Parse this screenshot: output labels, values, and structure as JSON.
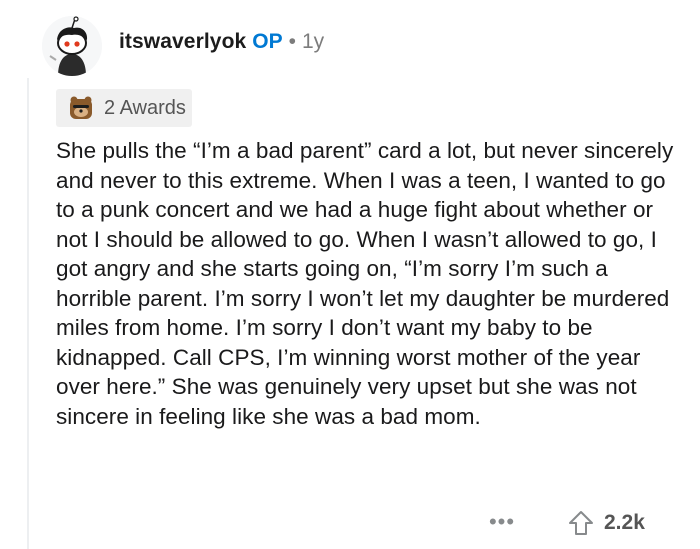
{
  "comment": {
    "username": "itswaverlyok",
    "op_badge": "OP",
    "separator": "•",
    "age": "1y",
    "awards_label": "2 Awards",
    "body": "She pulls the “I’m a bad parent” card a lot, but never sincerely and never to this extreme. When I was a teen, I wanted to go to a punk concert and we had a huge fight about whether or not I should be allowed to go. When I wasn’t allowed to go, I got angry and she starts going on, “I’m sorry I’m such a horrible parent. I’m sorry I won’t let my daughter be murdered miles from home. I’m sorry I don’t want my baby to be kidnapped. Call CPS, I’m winning worst mother of the year over here.” She was genuinely very upset but she was not sincere in feeling like she was a bad mom.",
    "more_label": "•••",
    "score": "2.2k"
  },
  "icons": {
    "avatar": "snoo-avatar",
    "award": "award-icon",
    "upvote": "upvote-arrow-icon",
    "more": "more-options-icon"
  },
  "colors": {
    "op": "#0079d3",
    "muted": "#7c7c7c",
    "award_bg": "#f0f0f0"
  }
}
